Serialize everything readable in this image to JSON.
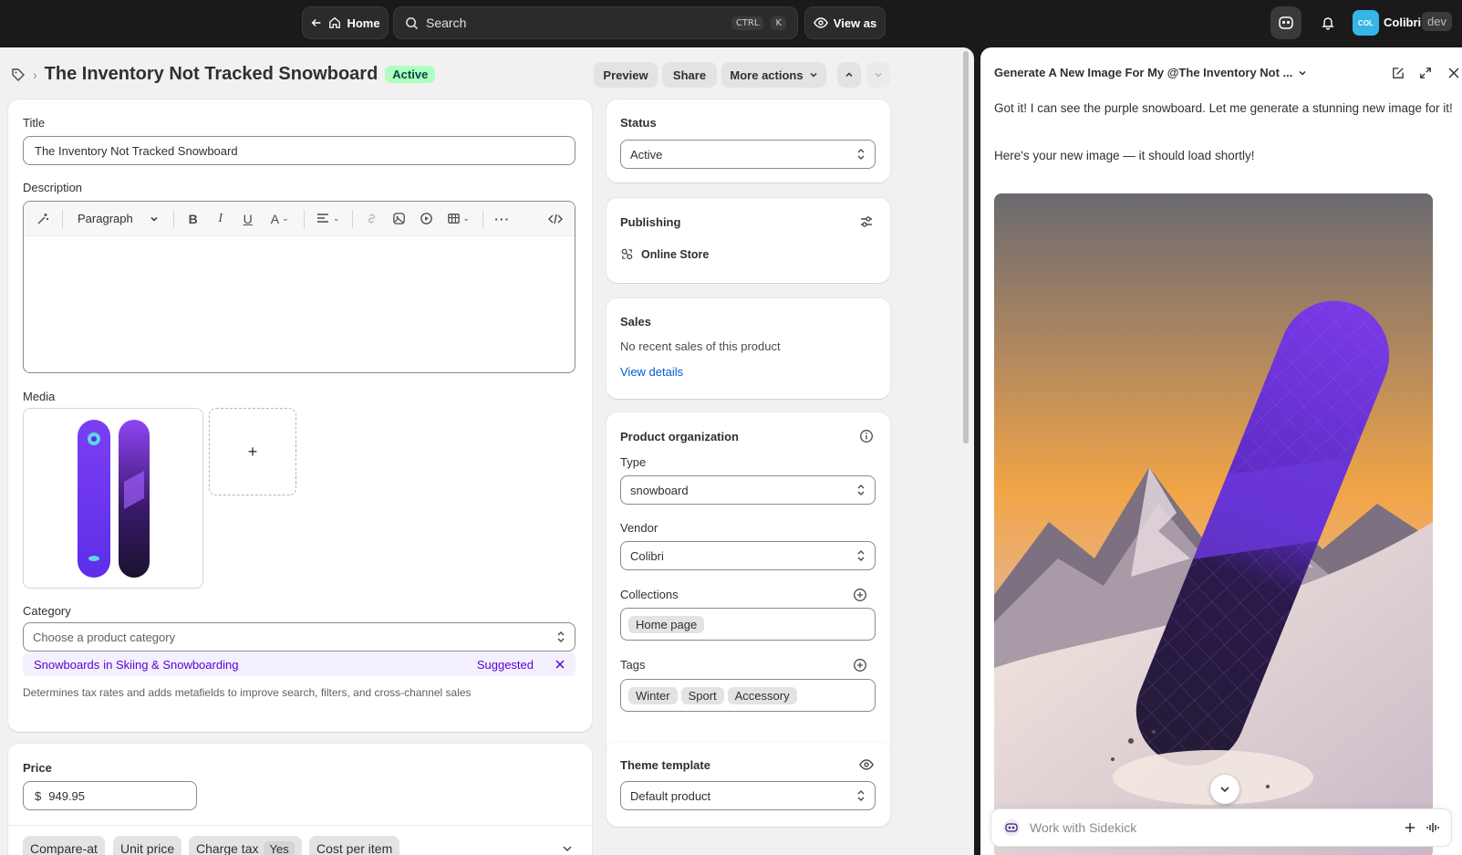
{
  "topbar": {
    "home_label": "Home",
    "search_placeholder": "Search",
    "shortcut_ctrl": "CTRL",
    "shortcut_k": "K",
    "view_as_label": "View as",
    "avatar_initials": "COL",
    "store_name": "Colibri",
    "env_badge": "dev"
  },
  "product": {
    "title": "The Inventory Not Tracked Snowboard",
    "status_badge": "Active",
    "actions": {
      "preview": "Preview",
      "share": "Share",
      "more": "More actions"
    },
    "fields": {
      "title_label": "Title",
      "title_value": "The Inventory Not Tracked Snowboard",
      "description_label": "Description",
      "paragraph_style": "Paragraph",
      "media_label": "Media",
      "add_media": "+",
      "category_label": "Category",
      "category_placeholder": "Choose a product category",
      "category_suggestion_name": "Snowboards",
      "category_suggestion_path": "in Skiing & Snowboarding",
      "category_suggested": "Suggested",
      "category_help": "Determines tax rates and adds metafields to improve search, filters, and cross-channel sales"
    },
    "price": {
      "label": "Price",
      "currency": "$",
      "value": "949.95",
      "pills": [
        "Compare-at",
        "Unit price",
        "Charge tax",
        "Cost per item"
      ],
      "charge_tax_value": "Yes"
    }
  },
  "status_card": {
    "label": "Status",
    "value": "Active"
  },
  "publishing_card": {
    "label": "Publishing",
    "channel": "Online Store"
  },
  "sales_card": {
    "label": "Sales",
    "text": "No recent sales of this product",
    "link": "View details"
  },
  "organization_card": {
    "label": "Product organization",
    "type_label": "Type",
    "type_value": "snowboard",
    "vendor_label": "Vendor",
    "vendor_value": "Colibri",
    "collections_label": "Collections",
    "collections": [
      "Home page"
    ],
    "tags_label": "Tags",
    "tags": [
      "Winter",
      "Sport",
      "Accessory"
    ]
  },
  "theme_card": {
    "label": "Theme template",
    "value": "Default product"
  },
  "sidekick": {
    "title": "Generate A New Image For My @The Inventory Not ...",
    "messages": [
      "Got it! I can see the purple snowboard. Let me generate a stunning new image for it!",
      "Here's your new image — it should load shortly!"
    ],
    "composer_placeholder": "Work with Sidekick",
    "colors": {
      "accent": "#005bd3",
      "badge_green": "#affebf",
      "suggest_purple": "#5700d1"
    }
  }
}
